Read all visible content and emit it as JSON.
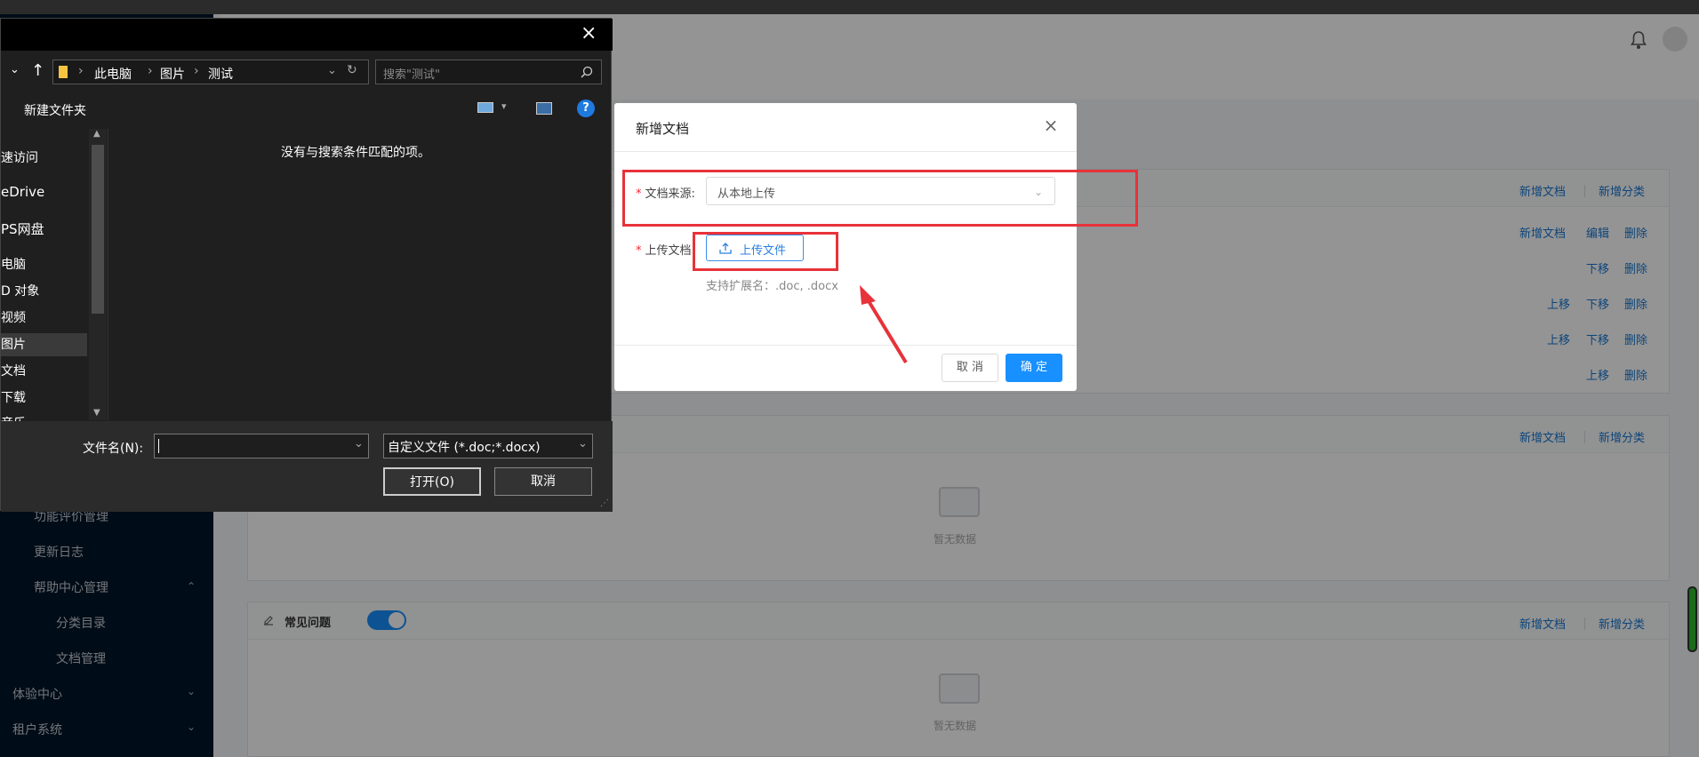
{
  "sidebar": {
    "items": [
      {
        "label": "功能评价管理"
      },
      {
        "label": "更新日志"
      },
      {
        "label": "帮助中心管理",
        "expanded": true
      },
      {
        "label": "分类目录"
      },
      {
        "label": "文档管理"
      },
      {
        "label": "体验中心"
      },
      {
        "label": "租户系统"
      }
    ]
  },
  "main": {
    "panel1_actions": {
      "add_doc": "新增文档",
      "add_cat": "新增分类"
    },
    "rows": [
      {
        "a": "新增文档",
        "b": "编辑",
        "c": "删除"
      },
      {
        "a": "",
        "b": "下移",
        "c": "删除"
      },
      {
        "a": "上移",
        "b": "下移",
        "c": "删除"
      },
      {
        "a": "上移",
        "b": "下移",
        "c": "删除"
      },
      {
        "a": "",
        "b": "上移",
        "c": "删除"
      }
    ],
    "panel2_actions": {
      "add_doc": "新增文档",
      "add_cat": "新增分类"
    },
    "panel2_empty": "暂无数据",
    "panel3": {
      "title": "常见问题",
      "toggle_on": true,
      "add_doc": "新增文档",
      "add_cat": "新增分类",
      "empty": "暂无数据"
    }
  },
  "modal": {
    "title": "新增文档",
    "source_label": "文档来源:",
    "source_value": "从本地上传",
    "upload_label": "上传文档:",
    "upload_button": "上传文件",
    "hint": "支持扩展名：.doc, .docx",
    "cancel": "取 消",
    "confirm": "确 定"
  },
  "file_dialog": {
    "breadcrumb": [
      "此电脑",
      "图片",
      "测试"
    ],
    "search_placeholder": "搜索\"测试\"",
    "new_folder": "新建文件夹",
    "empty_message": "没有与搜索条件匹配的项。",
    "nav_items": [
      "速访问",
      "eDrive",
      "PS网盘",
      "电脑",
      "D 对象",
      "视频",
      "图片",
      "文档",
      "下载",
      "音乐"
    ],
    "filename_label": "文件名(N):",
    "filename_value": "",
    "filetype_value": "自定义文件 (*.doc;*.docx)",
    "open_button": "打开(O)",
    "cancel_button": "取消"
  },
  "colors": {
    "accent": "#1890ff",
    "sidebar": "#001529",
    "highlight": "#e8323a"
  }
}
